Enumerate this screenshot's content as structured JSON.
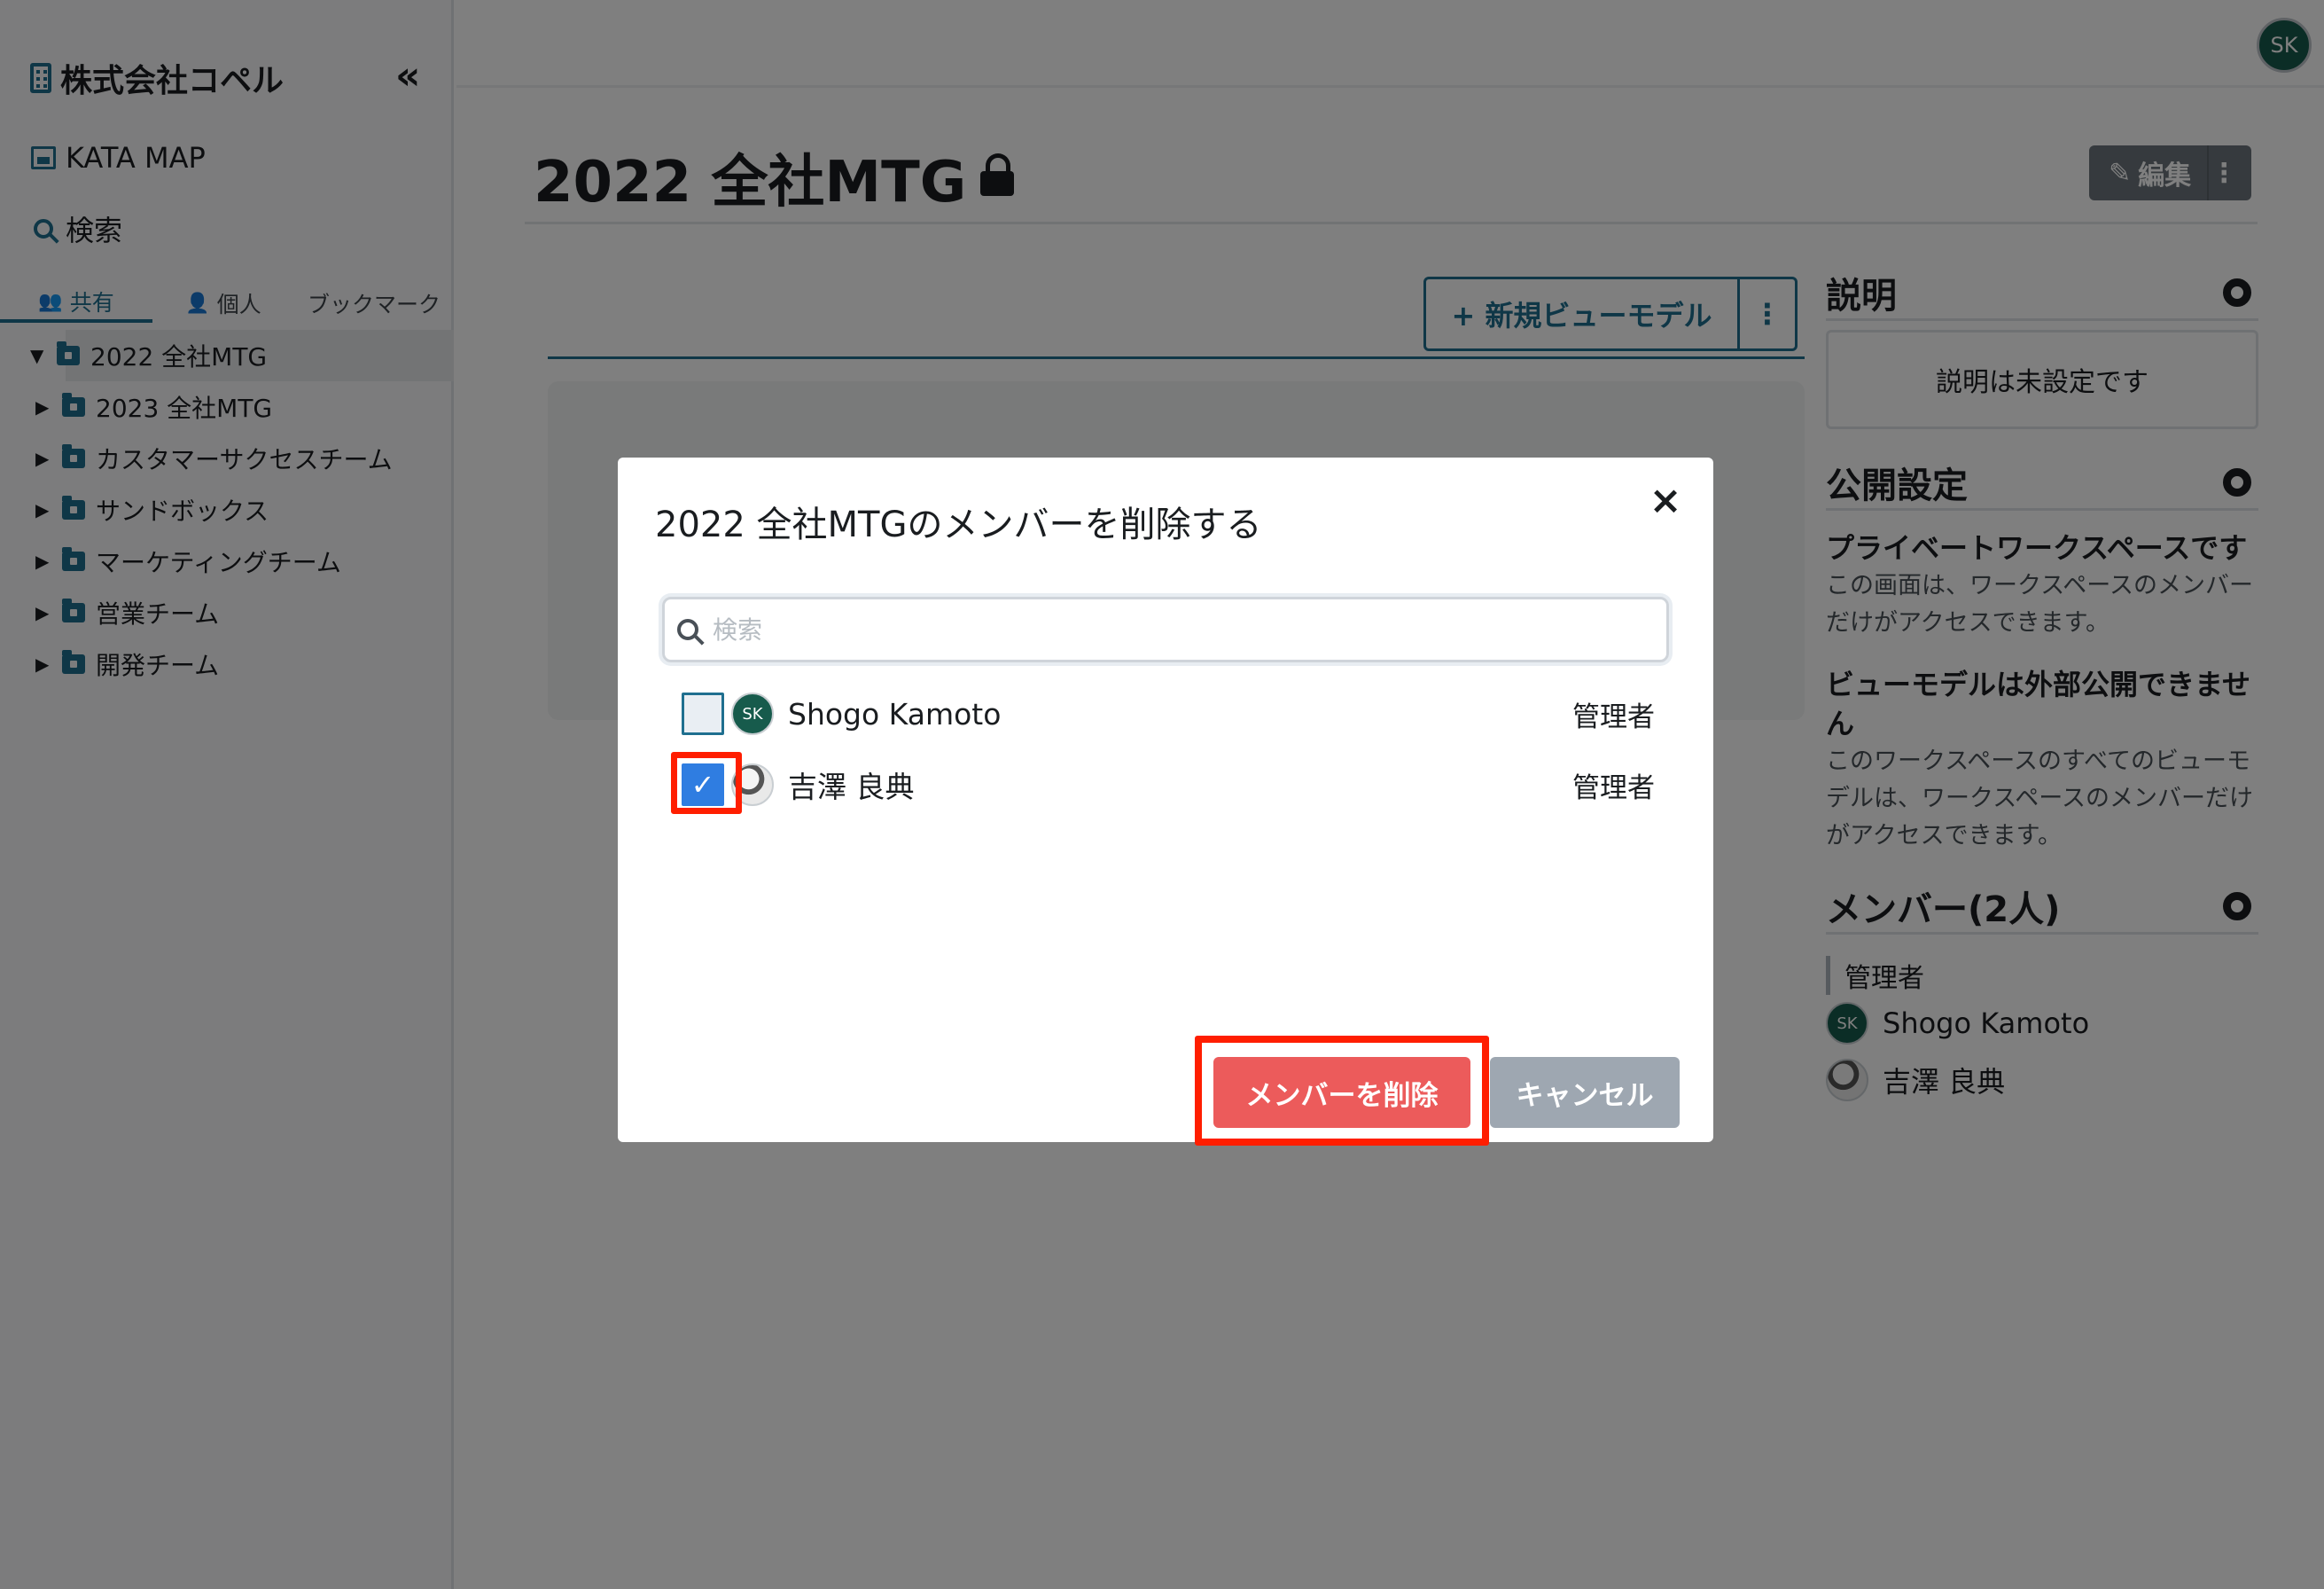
{
  "sidebar": {
    "org_name": "株式会社コペル",
    "collapse_glyph": "«",
    "links": [
      {
        "label": "KATA MAP",
        "icon": "map-icon"
      },
      {
        "label": "検索",
        "icon": "search-icon"
      }
    ],
    "tabs": [
      {
        "label": "共有",
        "icon": "users-icon",
        "active": true
      },
      {
        "label": "個人",
        "icon": "user-icon",
        "active": false
      },
      {
        "label": "ブックマーク",
        "icon": "",
        "active": false
      }
    ],
    "tree": [
      {
        "label": "2022 全社MTG",
        "expanded": true,
        "active": true
      },
      {
        "label": "2023 全社MTG",
        "expanded": false,
        "active": false
      },
      {
        "label": "カスタマーサクセスチーム",
        "expanded": false,
        "active": false
      },
      {
        "label": "サンドボックス",
        "expanded": false,
        "active": false
      },
      {
        "label": "マーケティングチーム",
        "expanded": false,
        "active": false
      },
      {
        "label": "営業チーム",
        "expanded": false,
        "active": false
      },
      {
        "label": "開発チーム",
        "expanded": false,
        "active": false
      }
    ]
  },
  "header": {
    "user_initials": "SK"
  },
  "main": {
    "title": "2022 全社MTG",
    "edit_label": "編集",
    "new_view_model_label": "+ 新規ビューモデル"
  },
  "side_panel": {
    "description_heading": "説明",
    "description_empty": "説明は未設定です",
    "visibility_heading": "公開設定",
    "visibility_title": "プライベートワークスペースです",
    "visibility_text": "この画面は、ワークスペースのメンバーだけがアクセスできます。",
    "viewmodel_title": "ビューモデルは外部公開できません",
    "viewmodel_text": "このワークスペースのすべてのビューモデルは、ワークスペースのメンバーだけがアクセスできます。",
    "members_heading": "メンバー(2人)",
    "role_label": "管理者",
    "members": [
      {
        "name": "Shogo Kamoto",
        "initials": "SK"
      },
      {
        "name": "吉澤 良典",
        "initials": ""
      }
    ]
  },
  "modal": {
    "title": "2022 全社MTGのメンバーを削除する",
    "close_glyph": "×",
    "search_placeholder": "検索",
    "members": [
      {
        "name": "Shogo Kamoto",
        "initials": "SK",
        "role": "管理者",
        "checked": false
      },
      {
        "name": "吉澤 良典",
        "initials": "",
        "role": "管理者",
        "checked": true
      }
    ],
    "delete_label": "メンバーを削除",
    "cancel_label": "キャンセル"
  },
  "colors": {
    "accent": "#1f6f8f",
    "danger": "#ec5b5b",
    "highlight": "#ff1e00",
    "checkbox_checked": "#2f7de1"
  }
}
